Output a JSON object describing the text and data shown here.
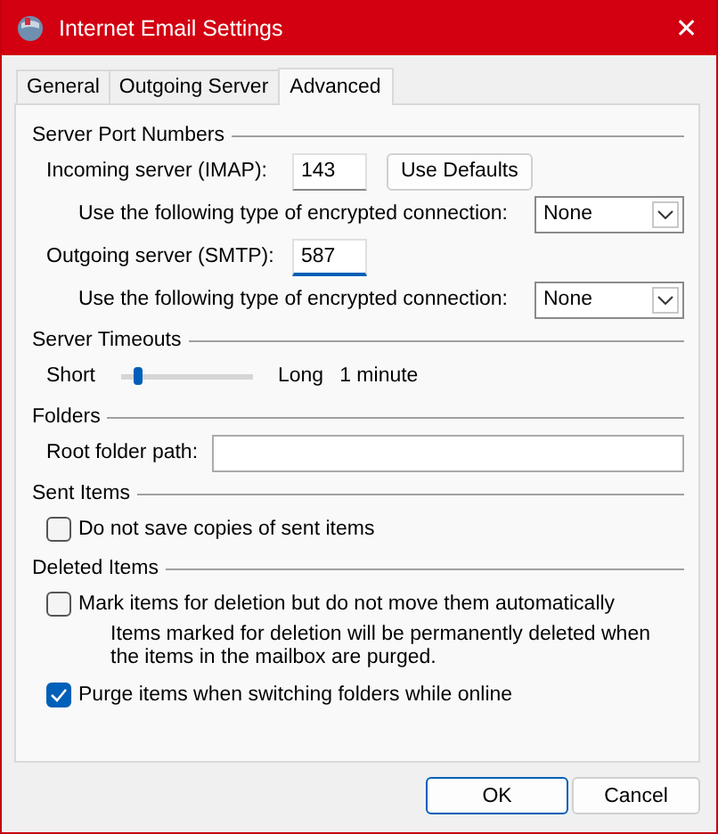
{
  "window": {
    "title": "Internet Email Settings",
    "close": "✕"
  },
  "tabs": [
    {
      "label": "General",
      "selected": false
    },
    {
      "label": "Outgoing Server",
      "selected": false
    },
    {
      "label": "Advanced",
      "selected": true
    }
  ],
  "port_numbers": {
    "title": "Server Port Numbers",
    "incoming": {
      "label": "Incoming server (IMAP):",
      "value": "143",
      "focused": false
    },
    "use_defaults": "Use Defaults",
    "incoming_encryption": {
      "label": "Use the following type of encrypted connection:",
      "value": "None"
    },
    "outgoing": {
      "label": "Outgoing server (SMTP):",
      "value": "587",
      "focused": true
    },
    "outgoing_encryption": {
      "label": "Use the following type of encrypted connection:",
      "value": "None"
    }
  },
  "timeouts": {
    "title": "Server Timeouts",
    "short": "Short",
    "long": "Long",
    "level": 0.1,
    "reading": "1 minute"
  },
  "folders": {
    "title": "Folders",
    "root_label": "Root folder path:"
  },
  "sent_items": {
    "title": "Sent Items",
    "items": [
      {
        "kind": "checkbox",
        "label": "Do not save copies of sent items",
        "checked": false
      }
    ]
  },
  "deleted_items": {
    "title": "Deleted Items",
    "items": [
      {
        "kind": "checkbox",
        "label": "Mark items for deletion but do not move them automatically",
        "checked": false
      },
      {
        "kind": "note",
        "text": "Items marked for deletion will be permanently deleted when the items in the mailbox are purged."
      },
      {
        "kind": "checkbox",
        "label": "Purge items when switching folders while online",
        "checked": true
      }
    ]
  },
  "buttons": [
    {
      "label": "OK",
      "default": true
    },
    {
      "label": "Cancel",
      "default": false
    }
  ]
}
